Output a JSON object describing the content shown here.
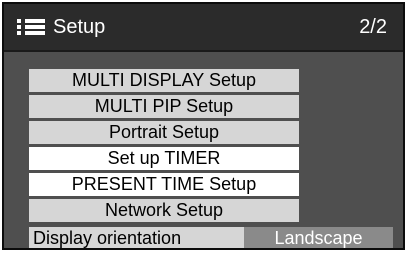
{
  "header": {
    "icon": "menu-list-icon",
    "title": "Setup",
    "page_indicator": "2/2"
  },
  "menu": {
    "items": [
      {
        "label": "MULTI DISPLAY Setup",
        "state": "normal"
      },
      {
        "label": "MULTI PIP Setup",
        "state": "normal"
      },
      {
        "label": "Portrait Setup",
        "state": "normal"
      },
      {
        "label": "Set up TIMER",
        "state": "highlighted"
      },
      {
        "label": "PRESENT TIME Setup",
        "state": "highlighted"
      },
      {
        "label": "Network Setup",
        "state": "normal"
      }
    ]
  },
  "status": {
    "label": "Display orientation",
    "value": "Landscape"
  }
}
